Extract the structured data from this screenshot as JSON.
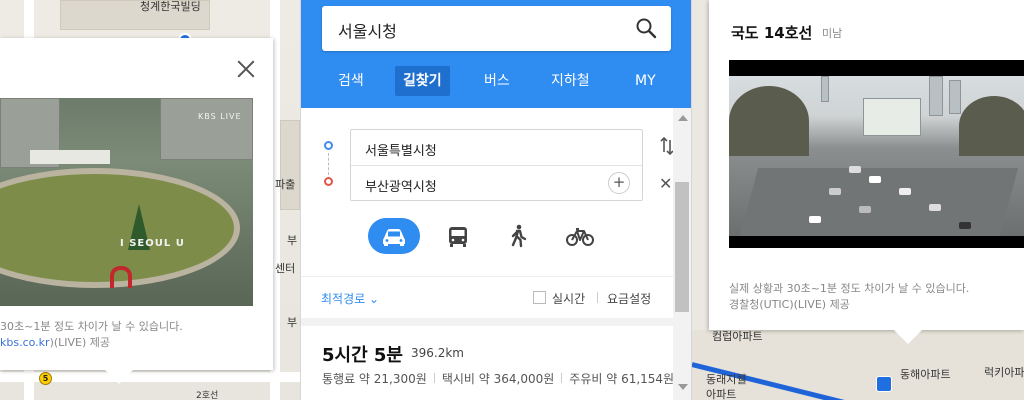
{
  "left_map": {
    "labels": {
      "top_label": "청계한국빌딩",
      "side_label": "파출",
      "label_bu1": "부",
      "label_bu2": "부",
      "label_center": "센터",
      "bottom_road": "2호선"
    },
    "route_badge": "5",
    "popup": {
      "cam_text_seoul": "I SEOUL U",
      "cam_text_kbs": "KBS LIVE",
      "caption_line1": "30초~1분 정도 차이가 날 수 있습니다.",
      "caption_line2_link": "kbs.co.kr",
      "caption_line2_rest": ")(LIVE) 제공"
    }
  },
  "search": {
    "query": "서울시청",
    "tabs": [
      {
        "label": "검색",
        "active": false
      },
      {
        "label": "길찾기",
        "active": true
      },
      {
        "label": "버스",
        "active": false
      },
      {
        "label": "지하철",
        "active": false
      },
      {
        "label": "MY",
        "active": false
      }
    ],
    "start": "서울특별시청",
    "end": "부산광역시청",
    "add_waypoint": "+",
    "clear": "✕",
    "modes": [
      "car-icon",
      "bus-icon",
      "walk-icon",
      "bike-icon"
    ],
    "active_mode": "car",
    "sort_option": "최적경로 ⌄",
    "realtime_label": "실시간",
    "realtime_checked": false,
    "fare_settings": "요금설정",
    "result": {
      "time": "5시간 5분",
      "distance": "396.2km",
      "toll": "통행료 약 21,300원",
      "taxi": "택시비 약 364,000원",
      "fuel": "주유비 약 61,154원"
    }
  },
  "right_map": {
    "labels": {
      "apt1": "컴럽아파트",
      "apt2a": "동래지웰",
      "apt2b": "아파트",
      "apt3": "동해아파트",
      "apt4": "럭키아파"
    },
    "popup": {
      "title": "국도 14호선",
      "subtitle": "미남",
      "caption_line1": "실제 상황과 30초~1분 정도 차이가 날 수 있습니다.",
      "caption_line2": "경찰청(UTIC)(LIVE) 제공"
    }
  },
  "colors": {
    "brand_blue": "#2f8cf0",
    "active_tab": "#1e6fce",
    "start_dot": "#3f8cf0",
    "end_dot": "#e3544a",
    "route_line": "#1f63d8"
  }
}
